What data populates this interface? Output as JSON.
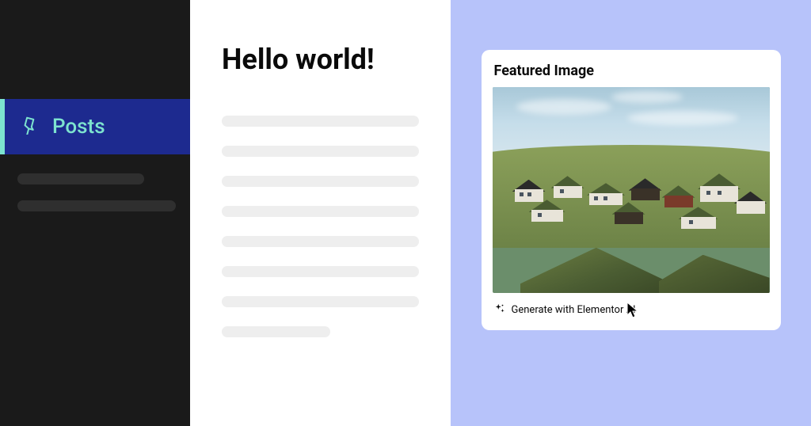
{
  "sidebar": {
    "items": [
      {
        "label": "Posts",
        "icon": "pin-icon",
        "active": true
      }
    ]
  },
  "editor": {
    "title": "Hello world!"
  },
  "featured": {
    "title": "Featured Image",
    "generate_label": "Generate with Elementor AI"
  }
}
